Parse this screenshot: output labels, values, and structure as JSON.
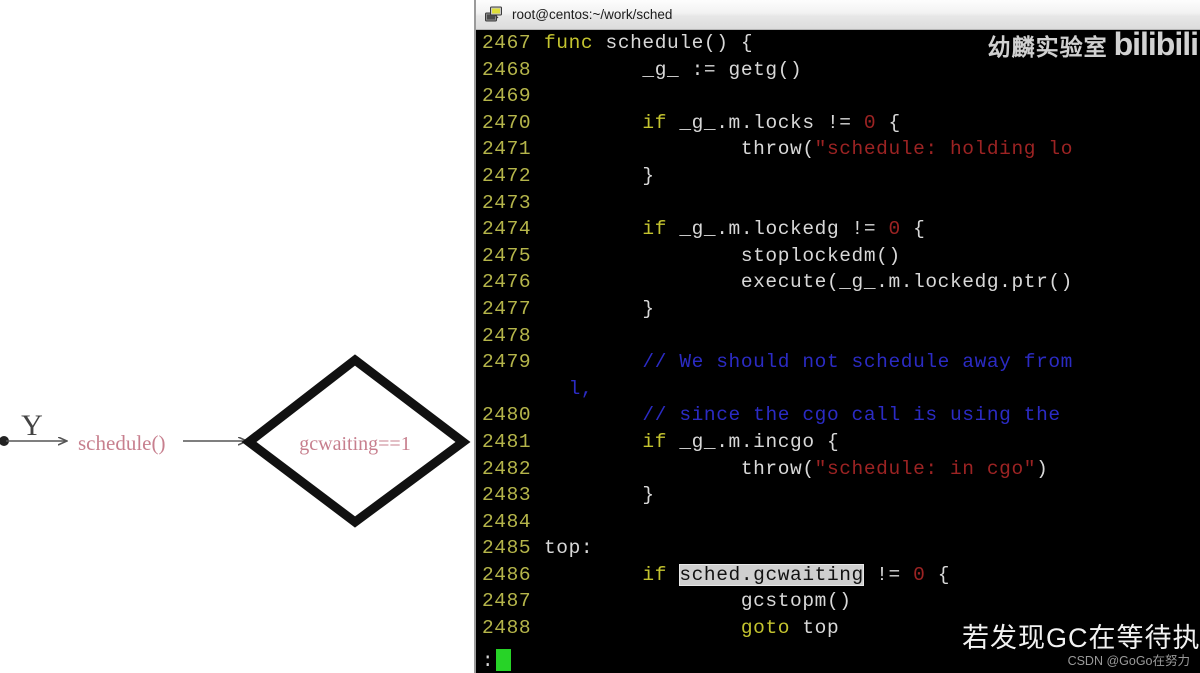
{
  "diagram": {
    "branch_label": "Y",
    "node_schedule": "schedule()",
    "node_decision": "gcwaiting==1",
    "text_color": "#c77f8e",
    "line_color": "#555555",
    "shape_color": "#000000"
  },
  "terminal": {
    "titlebar": {
      "icon": "putty-computer-icon",
      "title": "root@centos:~/work/sched"
    },
    "prompt": {
      "symbol": ":",
      "cursor": "block-cursor",
      "cursor_color": "#27d327"
    },
    "colors": {
      "background": "#000000",
      "line_number": "#b5b54a",
      "keyword": "#c4c42f",
      "plain": "#d8d8d8",
      "string": "#9c2323",
      "number": "#9c2323",
      "comment": "#2b2bc4",
      "selection_bg": "#cfcfcf",
      "selection_fg": "#111111"
    },
    "lines": [
      {
        "n": "2467",
        "tokens": [
          {
            "t": "kw",
            "s": "func "
          },
          {
            "t": "plain",
            "s": "schedule() {"
          }
        ]
      },
      {
        "n": "2468",
        "tokens": [
          {
            "t": "plain",
            "s": "        _g_ := getg()"
          }
        ]
      },
      {
        "n": "2469",
        "tokens": [
          {
            "t": "plain",
            "s": ""
          }
        ]
      },
      {
        "n": "2470",
        "tokens": [
          {
            "t": "plain",
            "s": "        "
          },
          {
            "t": "kw",
            "s": "if "
          },
          {
            "t": "plain",
            "s": "_g_.m.locks != "
          },
          {
            "t": "num",
            "s": "0"
          },
          {
            "t": "plain",
            "s": " {"
          }
        ]
      },
      {
        "n": "2471",
        "tokens": [
          {
            "t": "plain",
            "s": "                throw("
          },
          {
            "t": "str",
            "s": "\"schedule: holding lo"
          }
        ]
      },
      {
        "n": "2472",
        "tokens": [
          {
            "t": "plain",
            "s": "        }"
          }
        ]
      },
      {
        "n": "2473",
        "tokens": [
          {
            "t": "plain",
            "s": ""
          }
        ]
      },
      {
        "n": "2474",
        "tokens": [
          {
            "t": "plain",
            "s": "        "
          },
          {
            "t": "kw",
            "s": "if "
          },
          {
            "t": "plain",
            "s": "_g_.m.lockedg != "
          },
          {
            "t": "num",
            "s": "0"
          },
          {
            "t": "plain",
            "s": " {"
          }
        ]
      },
      {
        "n": "2475",
        "tokens": [
          {
            "t": "plain",
            "s": "                stoplockedm()"
          }
        ]
      },
      {
        "n": "2476",
        "tokens": [
          {
            "t": "plain",
            "s": "                execute(_g_.m.lockedg.ptr()"
          }
        ]
      },
      {
        "n": "2477",
        "tokens": [
          {
            "t": "plain",
            "s": "        }"
          }
        ]
      },
      {
        "n": "2478",
        "tokens": [
          {
            "t": "plain",
            "s": ""
          }
        ]
      },
      {
        "n": "2479",
        "tokens": [
          {
            "t": "plain",
            "s": "        "
          },
          {
            "t": "cmt",
            "s": "// We should not schedule away from"
          }
        ]
      },
      {
        "n": "",
        "wrap": true,
        "tokens": [
          {
            "t": "cmt",
            "s": "  l,"
          }
        ]
      },
      {
        "n": "2480",
        "tokens": [
          {
            "t": "plain",
            "s": "        "
          },
          {
            "t": "cmt",
            "s": "// since the cgo call is using the"
          }
        ]
      },
      {
        "n": "2481",
        "tokens": [
          {
            "t": "plain",
            "s": "        "
          },
          {
            "t": "kw",
            "s": "if "
          },
          {
            "t": "plain",
            "s": "_g_.m.incgo {"
          }
        ]
      },
      {
        "n": "2482",
        "tokens": [
          {
            "t": "plain",
            "s": "                throw("
          },
          {
            "t": "str",
            "s": "\"schedule: in cgo\""
          },
          {
            "t": "plain",
            "s": ")"
          }
        ]
      },
      {
        "n": "2483",
        "tokens": [
          {
            "t": "plain",
            "s": "        }"
          }
        ]
      },
      {
        "n": "2484",
        "tokens": [
          {
            "t": "plain",
            "s": ""
          }
        ]
      },
      {
        "n": "2485",
        "tokens": [
          {
            "t": "plain",
            "s": "top:"
          }
        ]
      },
      {
        "n": "2486",
        "tokens": [
          {
            "t": "plain",
            "s": "        "
          },
          {
            "t": "kw",
            "s": "if "
          },
          {
            "t": "sel",
            "s": "sched.gcwaiting"
          },
          {
            "t": "plain",
            "s": " != "
          },
          {
            "t": "num",
            "s": "0"
          },
          {
            "t": "plain",
            "s": " {"
          }
        ]
      },
      {
        "n": "2487",
        "tokens": [
          {
            "t": "plain",
            "s": "                gcstopm()"
          }
        ]
      },
      {
        "n": "2488",
        "tokens": [
          {
            "t": "plain",
            "s": "                "
          },
          {
            "t": "kw",
            "s": "goto "
          },
          {
            "t": "plain",
            "s": "top"
          }
        ]
      }
    ]
  },
  "overlays": {
    "watermark_cn": "幼麟实验室",
    "watermark_brand": "bilibili",
    "tv_logo": "bilibili-tv-icon",
    "subtitle": "若发现GC在等待执行",
    "csdn": "CSDN @GoGo在努力"
  }
}
